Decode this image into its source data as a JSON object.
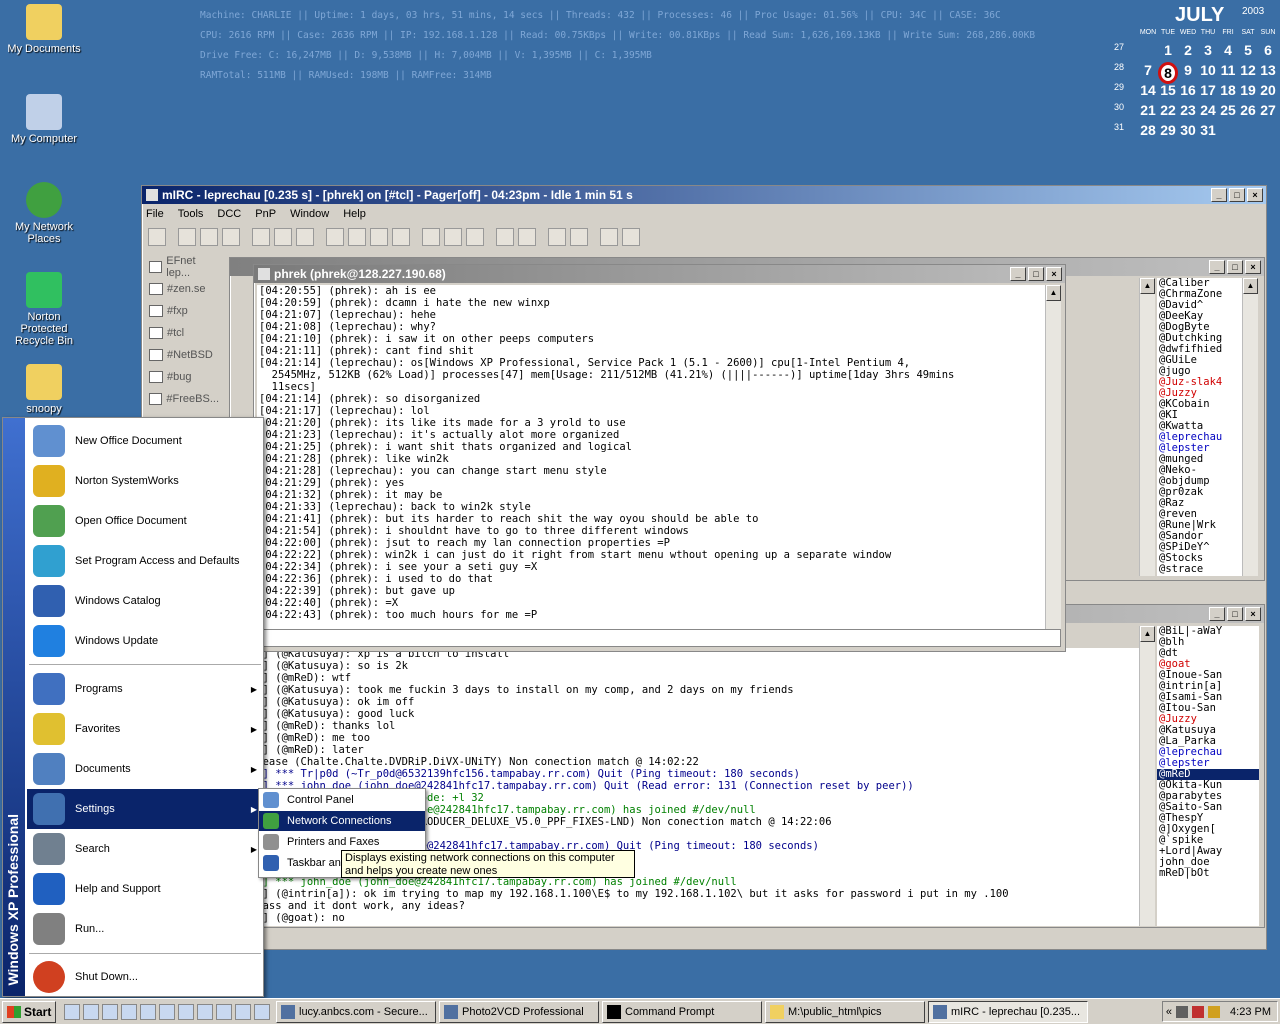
{
  "desktop": {
    "icons": [
      "My Documents",
      "My Computer",
      "My Network Places",
      "Norton Protected Recycle Bin",
      "snoopy"
    ]
  },
  "stats": {
    "lines": [
      "Machine: CHARLIE || Uptime: 1 days, 03 hrs, 51 mins, 14 secs || Threads: 432 || Processes: 46 || Proc Usage: 01.56% || CPU: 34C || CASE: 36C",
      "CPU: 2616 RPM || Case: 2636 RPM || IP: 192.168.1.128 || Read: 00.75KBps || Write: 00.81KBps || Read Sum: 1,626,169.13KB || Write Sum: 268,286.00KB",
      "Drive Free: C: 16,247MB || D: 9,538MB || H: 7,004MB || V: 1,395MB || C: 1,395MB",
      "RAMTotal: 511MB || RAMUsed: 198MB || RAMFree: 314MB"
    ]
  },
  "calendar": {
    "month": "JULY",
    "year": "2003",
    "weekdays": [
      "MON",
      "TUE",
      "WED",
      "THU",
      "FRI",
      "SAT",
      "SUN"
    ],
    "weeks": [
      {
        "n": "27",
        "days": [
          "",
          "1",
          "2",
          "3",
          "4",
          "5",
          "6"
        ]
      },
      {
        "n": "28",
        "days": [
          "7",
          "8",
          "9",
          "10",
          "11",
          "12",
          "13"
        ]
      },
      {
        "n": "29",
        "days": [
          "14",
          "15",
          "16",
          "17",
          "18",
          "19",
          "20"
        ]
      },
      {
        "n": "30",
        "days": [
          "21",
          "22",
          "23",
          "24",
          "25",
          "26",
          "27"
        ]
      },
      {
        "n": "31",
        "days": [
          "28",
          "29",
          "30",
          "31",
          "",
          "",
          ""
        ]
      }
    ],
    "today": "8"
  },
  "mirc": {
    "title": "mIRC - leprechau [0.235 s] - [phrek] on [#tcl] - Pager[off] - 04:23pm - Idle 1 min 51 s",
    "menu": [
      "File",
      "Tools",
      "DCC",
      "PnP",
      "Window",
      "Help"
    ],
    "channels": [
      "EFnet lep...",
      "#zen.se",
      "#fxp",
      "#tcl",
      "#NetBSD",
      "#bug",
      "#FreeBS..."
    ]
  },
  "query": {
    "title": "phrek (phrek@128.227.190.68)",
    "lines": [
      "[04:20:55] (phrek): ah is ee",
      "[04:20:59] (phrek): dcamn i hate the new winxp",
      "[04:21:07] (leprechau): hehe",
      "[04:21:08] (leprechau): why?",
      "[04:21:10] (phrek): i saw it on other peeps computers",
      "[04:21:11] (phrek): cant find shit",
      "[04:21:14] (leprechau): os[Windows XP Professional, Service Pack 1 (5.1 - 2600)] cpu[1-Intel Pentium 4,",
      "  2545MHz, 512KB (62% Load)] processes[47] mem[Usage: 211/512MB (41.21%) (||||------)] uptime[1day 3hrs 49mins",
      "  11secs]",
      "[04:21:14] (phrek): so disorganized",
      "[04:21:17] (leprechau): lol",
      "[04:21:20] (phrek): its like its made for a 3 yrold to use",
      "[04:21:23] (leprechau): it's actually alot more organized",
      "[04:21:25] (phrek): i want shit thats organized and logical",
      "[04:21:28] (phrek): like win2k",
      "[04:21:28] (leprechau): you can change start menu style",
      "[04:21:29] (phrek): yes",
      "[04:21:32] (phrek): it may be",
      "[04:21:33] (leprechau): back to win2k style",
      "[04:21:41] (phrek): but its harder to reach shit the way oyou should be able to",
      "[04:21:54] (phrek): i shouldnt have to go to three different windows",
      "[04:22:00] (phrek): jsut to reach my lan connection properties =P",
      "[04:22:22] (phrek): win2k i can just do it right from start menu wthout opening up a separate window",
      "[04:22:34] (phrek): i see your a seti guy =X",
      "[04:22:36] (phrek): i used to do that",
      "[04:22:39] (phrek): but gave up",
      "[04:22:40] (phrek): =X",
      "[04:22:43] (phrek): too much hours for me =P"
    ]
  },
  "chan2": {
    "lines": [
      {
        "t": "47:01] (@Katusuya): xp is a bitch to install",
        "c": "#000"
      },
      {
        "t": "47:02] (@Katusuya): so is 2k",
        "c": "#000"
      },
      {
        "t": "47:09] (@mReD): wtf",
        "c": "#000"
      },
      {
        "t": "47:11] (@Katusuya): took me fuckin 3 days to install on my comp, and 2 days on my friends",
        "c": "#000"
      },
      {
        "t": "47:53] (@Katusuya): ok im off",
        "c": "#000"
      },
      {
        "t": "47:54] (@Katusuya): good luck",
        "c": "#000"
      },
      {
        "t": "48:01] (@mReD): thanks lol",
        "c": "#000"
      },
      {
        "t": "48:02] (@mReD): me too",
        "c": "#000"
      },
      {
        "t": "48:03] (@mReD): later",
        "c": "#000"
      },
      {
        "t": "] Release (Chalte.Chalte.DVDRiP.DiVX-UNiTY) Non conection match @ 14:02:22",
        "c": "#000"
      },
      {
        "t": "13:08] *** Tr|p0d (~Tr_p0d@6532139hfc156.tampabay.rr.com) Quit (Ping timeout: 180 seconds)",
        "c": "#00008b"
      },
      {
        "t": "13:32] *** john_doe (john_doe@242841hfc17.tampabay.rr.com) Quit (Read error: 131 (Connection reset by peer))",
        "c": "#00008b"
      },
      {
        "t": "                          ts mode: +l 32",
        "c": "#008000"
      },
      {
        "t": "                          hn_doe@242841hfc17.tampabay.rr.com) has joined #/dev/null",
        "c": "#008000"
      },
      {
        "t": "                          RD_PRODUCER_DELUXE_V5.0_PPF_FIXES-LND) Non conection match @ 14:22:06",
        "c": "#000"
      },
      {
        "t": "                          ed",
        "c": "#000"
      },
      {
        "t": "                          n_doe@242841hfc17.tampabay.rr.com) Quit (Ping timeout: 180 seconds)",
        "c": "#00008b"
      },
      {
        "t": "                          .com) has joined #/dev/null",
        "c": "#008000"
      },
      {
        "t": "                          .com) Quit (Ping timeout: 180 seconds)",
        "c": "#00008b"
      },
      {
        "t": "13:02] *** john_doe (john_doe@242841hfc17.tampabay.rr.com) has joined #/dev/null",
        "c": "#008000"
      },
      {
        "t": "13:01] (@intrin[a]): ok im trying to map my 192.168.1.100\\E$ to my 192.168.1.102\\ but it asks for password i put in my .100",
        "c": "#000"
      },
      {
        "t": "min pass and it dont work, any ideas?",
        "c": "#000"
      },
      {
        "t": "22:10] (@goat): no",
        "c": "#000"
      }
    ]
  },
  "nicks1": [
    {
      "n": "@Caliber",
      "c": "#000"
    },
    {
      "n": "@ChrmaZone",
      "c": "#000"
    },
    {
      "n": "@David^",
      "c": "#000"
    },
    {
      "n": "@DeeKay",
      "c": "#000"
    },
    {
      "n": "@DogByte",
      "c": "#000"
    },
    {
      "n": "@Dutchking",
      "c": "#000"
    },
    {
      "n": "@dwfifhied",
      "c": "#000"
    },
    {
      "n": "@GUiLe",
      "c": "#000"
    },
    {
      "n": "@jugo",
      "c": "#000"
    },
    {
      "n": "@Juz-slak4",
      "c": "#d00000"
    },
    {
      "n": "@Juzzy",
      "c": "#d00000"
    },
    {
      "n": "@KCobain",
      "c": "#000"
    },
    {
      "n": "@KI",
      "c": "#000"
    },
    {
      "n": "@Kwatta",
      "c": "#000"
    },
    {
      "n": "@leprechau",
      "c": "#0000c0"
    },
    {
      "n": "@lepster",
      "c": "#0000c0"
    },
    {
      "n": "@munged",
      "c": "#000"
    },
    {
      "n": "@Neko-",
      "c": "#000"
    },
    {
      "n": "@objdump",
      "c": "#000"
    },
    {
      "n": "@pr0zak",
      "c": "#000"
    },
    {
      "n": "@Raz",
      "c": "#000"
    },
    {
      "n": "@reven",
      "c": "#000"
    },
    {
      "n": "@Rune|Wrk",
      "c": "#000"
    },
    {
      "n": "@Sandor",
      "c": "#000"
    },
    {
      "n": "@SPiDeY^",
      "c": "#000"
    },
    {
      "n": "@Stocks",
      "c": "#000"
    },
    {
      "n": "@strace",
      "c": "#000"
    }
  ],
  "nicks2": [
    {
      "n": "@BiL|-aWaY",
      "c": "#000"
    },
    {
      "n": "@blh",
      "c": "#000"
    },
    {
      "n": "@dt",
      "c": "#000"
    },
    {
      "n": "@goat",
      "c": "#d00000"
    },
    {
      "n": "@Inoue-San",
      "c": "#000"
    },
    {
      "n": "@intrin[a]",
      "c": "#000"
    },
    {
      "n": "@Isami-San",
      "c": "#000"
    },
    {
      "n": "@Itou-San",
      "c": "#000"
    },
    {
      "n": "@Juzzy",
      "c": "#d00000"
    },
    {
      "n": "@Katusuya",
      "c": "#000"
    },
    {
      "n": "@La_Parka",
      "c": "#000"
    },
    {
      "n": "@leprechau",
      "c": "#0000c0"
    },
    {
      "n": "@lepster",
      "c": "#0000c0"
    },
    {
      "n": "@mReD",
      "c": "sel"
    },
    {
      "n": "@Okita-Kun",
      "c": "#000"
    },
    {
      "n": "@parabytes",
      "c": "#000"
    },
    {
      "n": "@Saito-San",
      "c": "#000"
    },
    {
      "n": "@ThespY",
      "c": "#000"
    },
    {
      "n": "@]Oxygen[",
      "c": "#000"
    },
    {
      "n": "@`spike",
      "c": "#000"
    },
    {
      "n": "+Lord|Away",
      "c": "#000"
    },
    {
      "n": "john_doe",
      "c": "#000"
    },
    {
      "n": "mReD|bOt",
      "c": "#000"
    }
  ],
  "startmenu": {
    "side": "Windows XP Professional",
    "top": [
      "New Office Document",
      "Norton SystemWorks",
      "Open Office Document",
      "Set Program Access and Defaults",
      "Windows Catalog",
      "Windows Update"
    ],
    "mid": [
      "Programs",
      "Favorites",
      "Documents",
      "Settings",
      "Search",
      "Help and Support",
      "Run..."
    ],
    "bottom": "Shut Down..."
  },
  "settings_sub": [
    "Control Panel",
    "Network Connections",
    "Printers and Faxes",
    "Taskbar and Start Menu"
  ],
  "tooltip": "Displays existing network connections on this computer and helps you create new ones",
  "taskbar": {
    "start": "Start",
    "buttons": [
      "lucy.anbcs.com - Secure...",
      "Photo2VCD Professional",
      "Command Prompt",
      "M:\\public_html\\pics",
      "mIRC - leprechau [0.235..."
    ],
    "clock": "4:23 PM"
  }
}
